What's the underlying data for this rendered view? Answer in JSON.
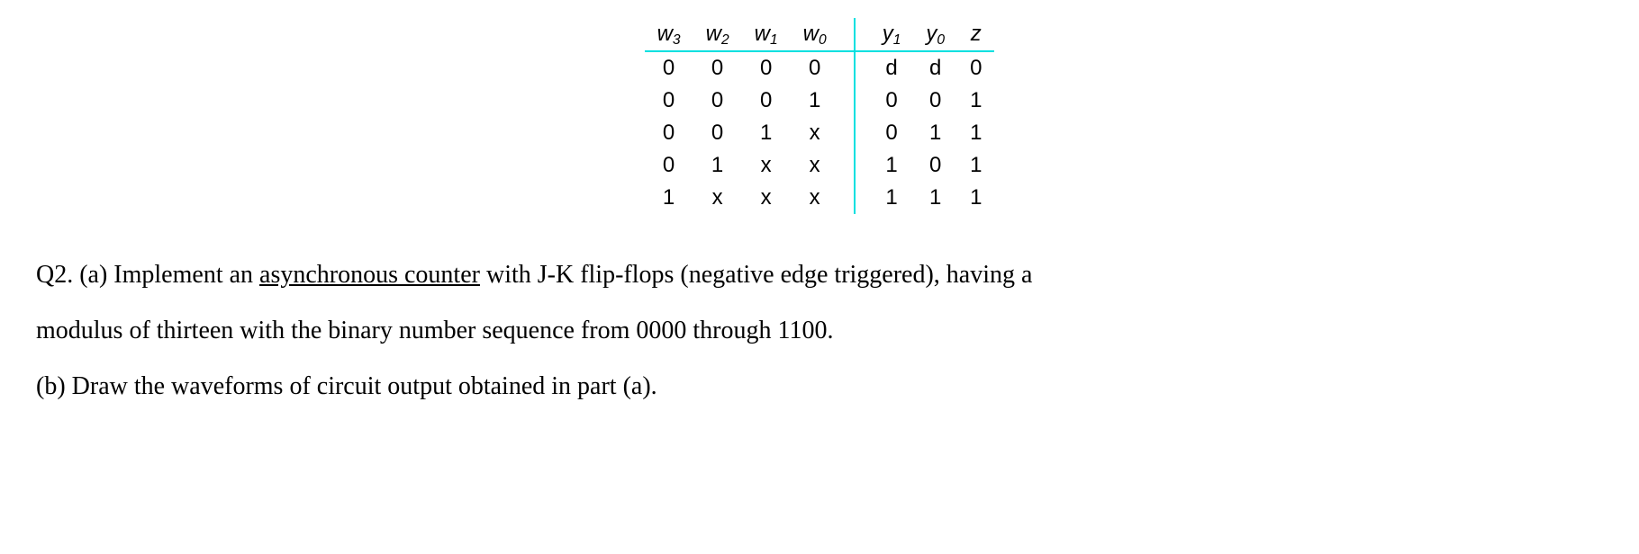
{
  "table": {
    "headers": {
      "w3_base": "w",
      "w3_sub": "3",
      "w2_base": "w",
      "w2_sub": "2",
      "w1_base": "w",
      "w1_sub": "1",
      "w0_base": "w",
      "w0_sub": "0",
      "y1_base": "y",
      "y1_sub": "1",
      "y0_base": "y",
      "y0_sub": "0",
      "z": "z"
    },
    "rows": [
      {
        "w3": "0",
        "w2": "0",
        "w1": "0",
        "w0": "0",
        "y1": "d",
        "y0": "d",
        "z": "0"
      },
      {
        "w3": "0",
        "w2": "0",
        "w1": "0",
        "w0": "1",
        "y1": "0",
        "y0": "0",
        "z": "1"
      },
      {
        "w3": "0",
        "w2": "0",
        "w1": "1",
        "w0": "x",
        "y1": "0",
        "y0": "1",
        "z": "1"
      },
      {
        "w3": "0",
        "w2": "1",
        "w1": "x",
        "w0": "x",
        "y1": "1",
        "y0": "0",
        "z": "1"
      },
      {
        "w3": "1",
        "w2": "x",
        "w1": "x",
        "w0": "x",
        "y1": "1",
        "y0": "1",
        "z": "1"
      }
    ]
  },
  "question": {
    "part_a_prefix": "Q2. (a) Implement an ",
    "part_a_underlined": "asynchronous counter",
    "part_a_suffix": " with J-K flip-flops (negative edge triggered), having a",
    "part_a_line2": "modulus of thirteen with the binary number sequence from 0000 through 1100.",
    "part_b": "(b) Draw the waveforms of circuit output obtained in part (a)."
  }
}
